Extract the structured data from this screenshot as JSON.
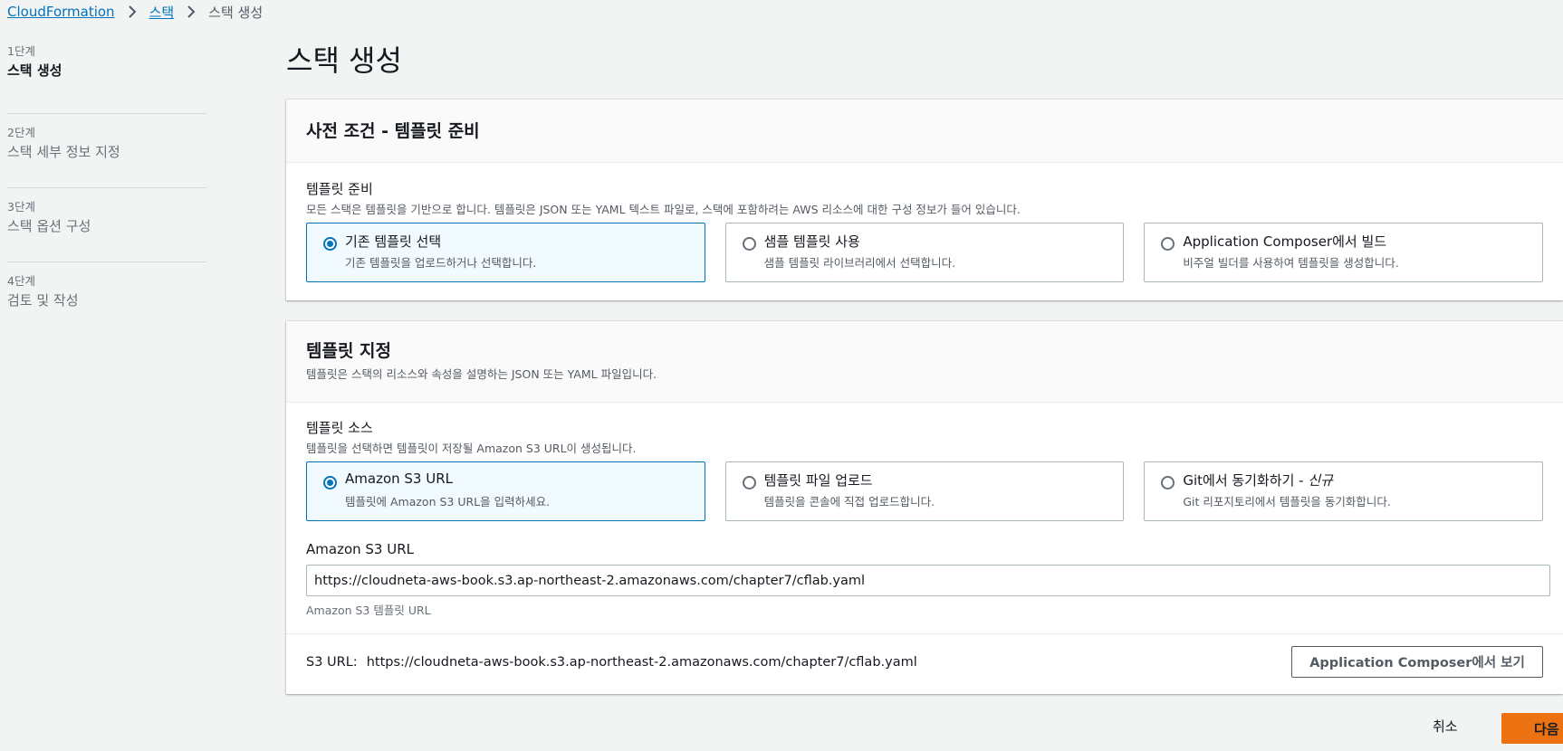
{
  "breadcrumb": {
    "items": [
      "CloudFormation",
      "스택"
    ],
    "current": "스택 생성"
  },
  "steps": [
    {
      "num": "1단계",
      "title": "스택 생성"
    },
    {
      "num": "2단계",
      "title": "스택 세부 정보 지정"
    },
    {
      "num": "3단계",
      "title": "스택 옵션 구성"
    },
    {
      "num": "4단계",
      "title": "검토 및 작성"
    }
  ],
  "page_title": "스택 생성",
  "prereq": {
    "title": "사전 조건 - 템플릿 준비",
    "field_label": "템플릿 준비",
    "field_desc": "모든 스택은 템플릿을 기반으로 합니다. 템플릿은 JSON 또는 YAML 텍스트 파일로, 스택에 포함하려는 AWS 리소스에 대한 구성 정보가 들어 있습니다.",
    "options": [
      {
        "title": "기존 템플릿 선택",
        "desc": "기존 템플릿을 업로드하거나 선택합니다.",
        "selected": true
      },
      {
        "title": "샘플 템플릿 사용",
        "desc": "샘플 템플릿 라이브러리에서 선택합니다.",
        "selected": false
      },
      {
        "title": "Application Composer에서 빌드",
        "desc": "비주얼 빌더를 사용하여 템플릿을 생성합니다.",
        "selected": false
      }
    ]
  },
  "specify": {
    "title": "템플릿 지정",
    "desc": "템플릿은 스택의 리소스와 속성을 설명하는 JSON 또는 YAML 파일입니다.",
    "field_label": "템플릿 소스",
    "field_desc": "템플릿을 선택하면 템플릿이 저장될 Amazon S3 URL이 생성됩니다.",
    "options": [
      {
        "title": "Amazon S3 URL",
        "desc": "템플릿에 Amazon S3 URL을 입력하세요.",
        "selected": true
      },
      {
        "title": "템플릿 파일 업로드",
        "desc": "템플릿을 콘솔에 직접 업로드합니다.",
        "selected": false
      },
      {
        "title": "Git에서 동기화하기 - ",
        "title_new": "신규",
        "desc": "Git 리포지토리에서 템플릿을 동기화합니다.",
        "selected": false
      }
    ],
    "url_label": "Amazon S3 URL",
    "url_value": "https://cloudneta-aws-book.s3.ap-northeast-2.amazonaws.com/chapter7/cflab.yaml",
    "url_hint": "Amazon S3 템플릿 URL",
    "s3_url_label": "S3 URL:",
    "s3_url_value": "https://cloudneta-aws-book.s3.ap-northeast-2.amazonaws.com/chapter7/cflab.yaml",
    "view_button": "Application Composer에서 보기"
  },
  "actions": {
    "cancel": "취소",
    "next": "다음"
  },
  "colors": {
    "accent": "#0073bb",
    "primary_button": "#ec7211"
  }
}
